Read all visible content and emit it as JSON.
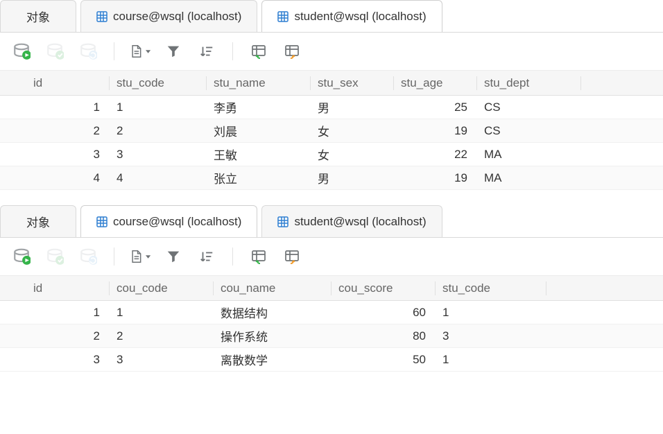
{
  "tabs": {
    "object_label": "对象",
    "course_label": "course@wsql (localhost)",
    "student_label": "student@wsql (localhost)"
  },
  "student_panel": {
    "active_tab": "student",
    "columns": {
      "id": "id",
      "stu_code": "stu_code",
      "stu_name": "stu_name",
      "stu_sex": "stu_sex",
      "stu_age": "stu_age",
      "stu_dept": "stu_dept"
    },
    "rows": [
      {
        "id": "1",
        "stu_code": "1",
        "stu_name": "李勇",
        "stu_sex": "男",
        "stu_age": "25",
        "stu_dept": "CS"
      },
      {
        "id": "2",
        "stu_code": "2",
        "stu_name": "刘晨",
        "stu_sex": "女",
        "stu_age": "19",
        "stu_dept": "CS"
      },
      {
        "id": "3",
        "stu_code": "3",
        "stu_name": "王敏",
        "stu_sex": "女",
        "stu_age": "22",
        "stu_dept": "MA"
      },
      {
        "id": "4",
        "stu_code": "4",
        "stu_name": "张立",
        "stu_sex": "男",
        "stu_age": "19",
        "stu_dept": "MA"
      }
    ]
  },
  "course_panel": {
    "active_tab": "course",
    "columns": {
      "id": "id",
      "cou_code": "cou_code",
      "cou_name": "cou_name",
      "cou_score": "cou_score",
      "stu_code": "stu_code"
    },
    "rows": [
      {
        "id": "1",
        "cou_code": "1",
        "cou_name": "数据结构",
        "cou_score": "60",
        "stu_code": "1"
      },
      {
        "id": "2",
        "cou_code": "2",
        "cou_name": "操作系统",
        "cou_score": "80",
        "stu_code": "3"
      },
      {
        "id": "3",
        "cou_code": "3",
        "cou_name": "离散数学",
        "cou_score": "50",
        "stu_code": "1"
      }
    ]
  }
}
